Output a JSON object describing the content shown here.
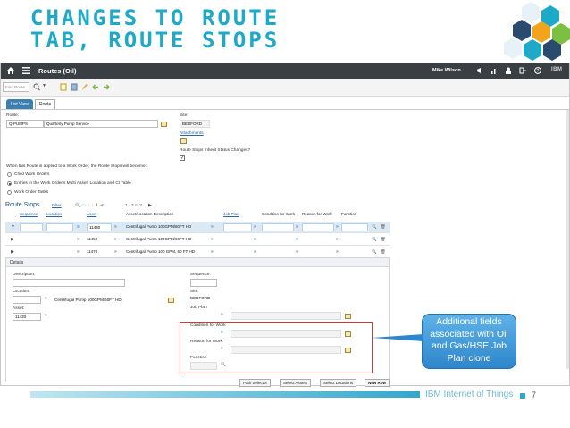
{
  "slide": {
    "title_line1": "Changes to Route",
    "title_line2": "Tab, Route Stops",
    "callout": "Additional fields associated with Oil and Gas/HSE Job Plan clone",
    "footer_brand": "IBM Internet of Things",
    "page_number": "7"
  },
  "app": {
    "title": "Routes (Oil)",
    "user": "Mike Wilson",
    "brand": "IBM",
    "find_placeholder": "Find Route",
    "tabs": {
      "list": "List View",
      "route": "Route"
    }
  },
  "header": {
    "route_label": "Route:",
    "route_value": "Q-PUMPS",
    "description_value": "Quarterly Pump Service",
    "site_label": "Site:",
    "site_value": "BEDFORD",
    "attachments_label": "Attachments",
    "inherit_label": "Route Stops Inherit Status Changes?"
  },
  "wo_options": {
    "prompt": "When this Route is applied to a Work Order, the Route Stops will become:",
    "opt1": "Child Work Orders",
    "opt2": "Entries in the Work Order's Multi Asset, Location and CI Table",
    "opt3": "Work Order Tasks"
  },
  "route_stops": {
    "title": "Route Stops",
    "filter": "Filter",
    "pager": "1 - 3 of 3",
    "columns": {
      "sequence": "Sequence",
      "location": "Location",
      "asset": "Asset",
      "asset_desc": "Asset/Location Description",
      "job_plan": "Job Plan",
      "condition": "Condition for Work",
      "reason": "Reason for Work",
      "function": "Function"
    },
    "rows": [
      {
        "asset": "11430",
        "desc": "Centrifugal Pump 100GPM/60FT HD"
      },
      {
        "asset": "11450",
        "desc": "Centrifugal Pump 100GPM/60FT HD"
      },
      {
        "asset": "11470",
        "desc": "Centrifugal Pump 100 GPM, 60 FT HD"
      }
    ]
  },
  "details": {
    "title": "Details",
    "description_label": "Description:",
    "sequence_label": "Sequence:",
    "location_label": "Location:",
    "location_desc": "Centrifugal Pump 100GPM/60FT HD",
    "site_label": "Site:",
    "site_value": "BEDFORD",
    "asset_label": "Asset:",
    "asset_value": "11430",
    "job_plan_label": "Job Plan",
    "condition_label": "Condition for Work",
    "reason_label": "Reason for Work",
    "function_label": "Function"
  },
  "buttons": {
    "path_selector": "Path Selector",
    "select_assets": "Select Assets",
    "select_locations": "Select Locations",
    "new_row": "New Row"
  },
  "colors": {
    "accent": "#1fa9c9",
    "topbar": "#3a3f44",
    "highlight": "#e03030",
    "callout": "#2e87cc"
  }
}
